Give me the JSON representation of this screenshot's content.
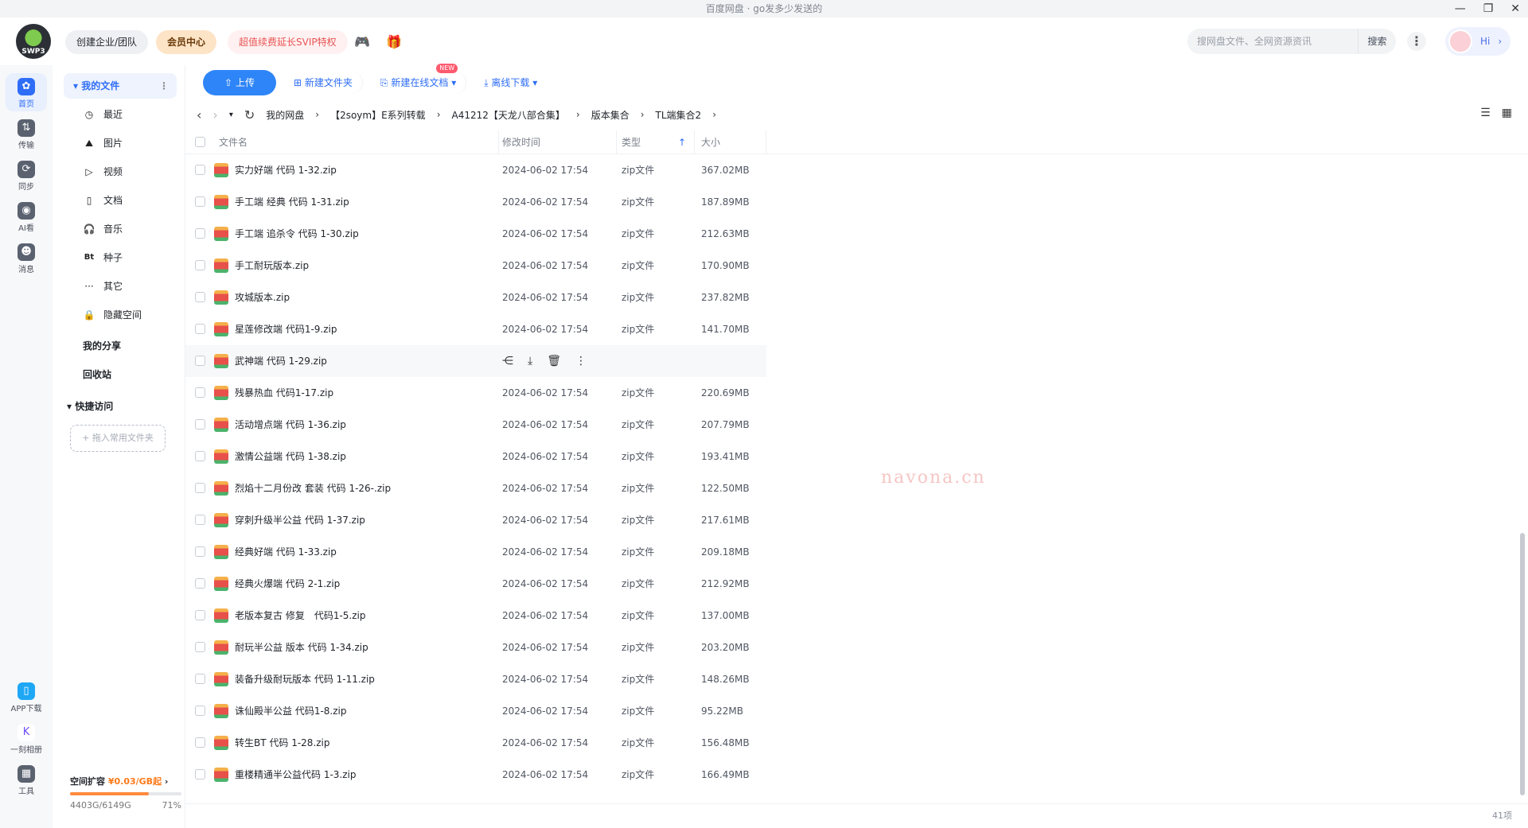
{
  "titlebar": {
    "title": "百度网盘 · go发多少发送的"
  },
  "header": {
    "team_label": "创建企业/团队",
    "vip_label": "会员中心",
    "promo_label": "超值续费延长SVIP特权",
    "search_placeholder": "搜网盘文件、全网资源资讯",
    "search_button": "搜索",
    "hi_label": "Hi",
    "logo_text": "SWP3"
  },
  "leftnav": {
    "items": [
      {
        "label": "首页",
        "icon": "home-icon"
      },
      {
        "label": "传输",
        "icon": "transfer-icon"
      },
      {
        "label": "同步",
        "icon": "sync-icon"
      },
      {
        "label": "AI看",
        "icon": "ai-icon"
      },
      {
        "label": "消息",
        "icon": "message-icon"
      },
      {
        "label": "APP下载",
        "icon": "phone-icon"
      },
      {
        "label": "一刻相册",
        "icon": "album-icon"
      },
      {
        "label": "工具",
        "icon": "tools-icon"
      }
    ]
  },
  "sidebar": {
    "my_files": "我的文件",
    "items": [
      {
        "label": "最近",
        "icon": "◷"
      },
      {
        "label": "图片",
        "icon": "⛰"
      },
      {
        "label": "视频",
        "icon": "▷"
      },
      {
        "label": "文档",
        "icon": "▯"
      },
      {
        "label": "音乐",
        "icon": "🎧"
      },
      {
        "label": "种子",
        "icon": "Bt"
      },
      {
        "label": "其它",
        "icon": "···"
      },
      {
        "label": "隐藏空间",
        "icon": "🔒"
      }
    ],
    "my_share": "我的分享",
    "recycle": "回收站",
    "quick_access": "快捷访问",
    "add_favorite": "+ 拖入常用文件夹",
    "quota_title": "空间扩容",
    "quota_price": "¥0.03/GB起",
    "quota_used": "4403G/6149G",
    "quota_percent": "71%",
    "quota_fraction": 0.71
  },
  "toolbar": {
    "upload": "上传",
    "new_folder": "新建文件夹",
    "new_doc": "新建在线文档",
    "new_badge": "NEW",
    "offline": "离线下载"
  },
  "breadcrumb": [
    "我的网盘",
    "【2soym】E系列转载",
    "A41212【天龙八部合集】",
    "版本集合",
    "TL端集合2"
  ],
  "table": {
    "headers": {
      "name": "文件名",
      "modified": "修改时间",
      "type": "类型",
      "size": "大小"
    },
    "rows": [
      {
        "name": "实力好端 代码 1-32.zip",
        "date": "2024-06-02 17:54",
        "type": "zip文件",
        "size": "367.02MB"
      },
      {
        "name": "手工端 经典 代码 1-31.zip",
        "date": "2024-06-02 17:54",
        "type": "zip文件",
        "size": "187.89MB"
      },
      {
        "name": "手工端 追杀令 代码 1-30.zip",
        "date": "2024-06-02 17:54",
        "type": "zip文件",
        "size": "212.63MB"
      },
      {
        "name": "手工耐玩版本.zip",
        "date": "2024-06-02 17:54",
        "type": "zip文件",
        "size": "170.90MB"
      },
      {
        "name": "攻城版本.zip",
        "date": "2024-06-02 17:54",
        "type": "zip文件",
        "size": "237.82MB"
      },
      {
        "name": "星莲修改端 代码1-9.zip",
        "date": "2024-06-02 17:54",
        "type": "zip文件",
        "size": "141.70MB"
      },
      {
        "name": "武神端 代码 1-29.zip",
        "date": "",
        "type": "",
        "size": "",
        "hover": true
      },
      {
        "name": "残暴热血 代码1-17.zip",
        "date": "2024-06-02 17:54",
        "type": "zip文件",
        "size": "220.69MB"
      },
      {
        "name": "活动增点端 代码 1-36.zip",
        "date": "2024-06-02 17:54",
        "type": "zip文件",
        "size": "207.79MB"
      },
      {
        "name": "激情公益端 代码 1-38.zip",
        "date": "2024-06-02 17:54",
        "type": "zip文件",
        "size": "193.41MB"
      },
      {
        "name": "烈焰十二月份改 套装 代码 1-26-.zip",
        "date": "2024-06-02 17:54",
        "type": "zip文件",
        "size": "122.50MB"
      },
      {
        "name": "穿刺升级半公益 代码 1-37.zip",
        "date": "2024-06-02 17:54",
        "type": "zip文件",
        "size": "217.61MB"
      },
      {
        "name": "经典好端 代码 1-33.zip",
        "date": "2024-06-02 17:54",
        "type": "zip文件",
        "size": "209.18MB"
      },
      {
        "name": "经典火爆端 代码 2-1.zip",
        "date": "2024-06-02 17:54",
        "type": "zip文件",
        "size": "212.92MB"
      },
      {
        "name": "老版本复古 修复　代码1-5.zip",
        "date": "2024-06-02 17:54",
        "type": "zip文件",
        "size": "137.00MB"
      },
      {
        "name": "耐玩半公益 版本 代码 1-34.zip",
        "date": "2024-06-02 17:54",
        "type": "zip文件",
        "size": "203.20MB"
      },
      {
        "name": "装备升级耐玩版本 代码 1-11.zip",
        "date": "2024-06-02 17:54",
        "type": "zip文件",
        "size": "148.26MB"
      },
      {
        "name": "诛仙殿半公益 代码1-8.zip",
        "date": "2024-06-02 17:54",
        "type": "zip文件",
        "size": "95.22MB"
      },
      {
        "name": "转生BT 代码 1-28.zip",
        "date": "2024-06-02 17:54",
        "type": "zip文件",
        "size": "156.48MB"
      },
      {
        "name": "重楼精通半公益代码 1-3.zip",
        "date": "2024-06-02 17:54",
        "type": "zip文件",
        "size": "166.49MB"
      }
    ]
  },
  "watermark": "navona.cn",
  "status": {
    "count": "41项"
  }
}
